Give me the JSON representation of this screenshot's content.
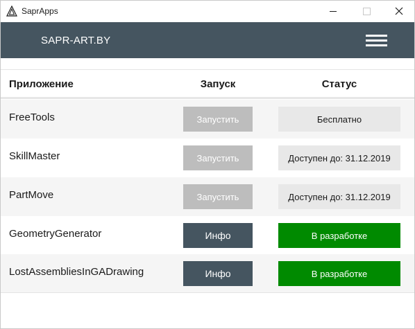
{
  "window": {
    "title": "SaprApps",
    "icon": "triangle-logo-icon"
  },
  "header": {
    "brand": "SAPR-ART.BY",
    "menu_icon": "hamburger-menu-icon"
  },
  "table": {
    "columns": {
      "app": "Приложение",
      "launch": "Запуск",
      "status": "Статус"
    },
    "rows": [
      {
        "name": "FreeTools",
        "action": "Запустить",
        "status": "Бесплатно"
      },
      {
        "name": "SkillMaster",
        "action": "Запустить",
        "status": "Доступен до: 31.12.2019"
      },
      {
        "name": "PartMove",
        "action": "Запустить",
        "status": "Доступен до: 31.12.2019"
      },
      {
        "name": "GeometryGenerator",
        "action": "Инфо",
        "status": "В разработке"
      },
      {
        "name": "LostAssembliesInGADrawing",
        "action": "Инфо",
        "status": "В разработке"
      }
    ]
  },
  "colors": {
    "header_bg": "#455560",
    "disabled_button": "#bdbdbd",
    "status_grey": "#e8e8e8",
    "status_green": "#008a00"
  }
}
